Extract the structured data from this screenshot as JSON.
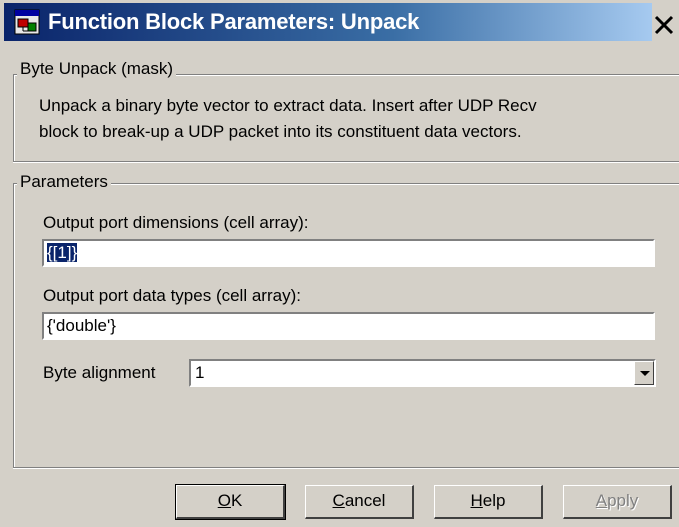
{
  "window": {
    "title": "Function Block Parameters: Unpack",
    "close_glyph": "✕"
  },
  "mask_group": {
    "legend": "Byte Unpack (mask)",
    "description_line1": "Unpack a binary byte vector to extract data. Insert after UDP Recv",
    "description_line2": "block to break-up a UDP packet into its constituent data vectors."
  },
  "params_group": {
    "legend": "Parameters",
    "dims_label": "Output port dimensions (cell array):",
    "dims_value": "{[1]}",
    "types_label": "Output port data types (cell array):",
    "types_value": "{'double'}",
    "align_label": "Byte alignment",
    "align_value": "1"
  },
  "buttons": {
    "ok_first": "O",
    "ok_rest": "K",
    "cancel_first": "C",
    "cancel_rest": "ancel",
    "help_first": "H",
    "help_rest": "elp",
    "apply_first": "A",
    "apply_rest": "pply"
  },
  "icons": {
    "app": "simulink-icon",
    "close": "close-icon",
    "dropdown": "chevron-down-icon"
  }
}
